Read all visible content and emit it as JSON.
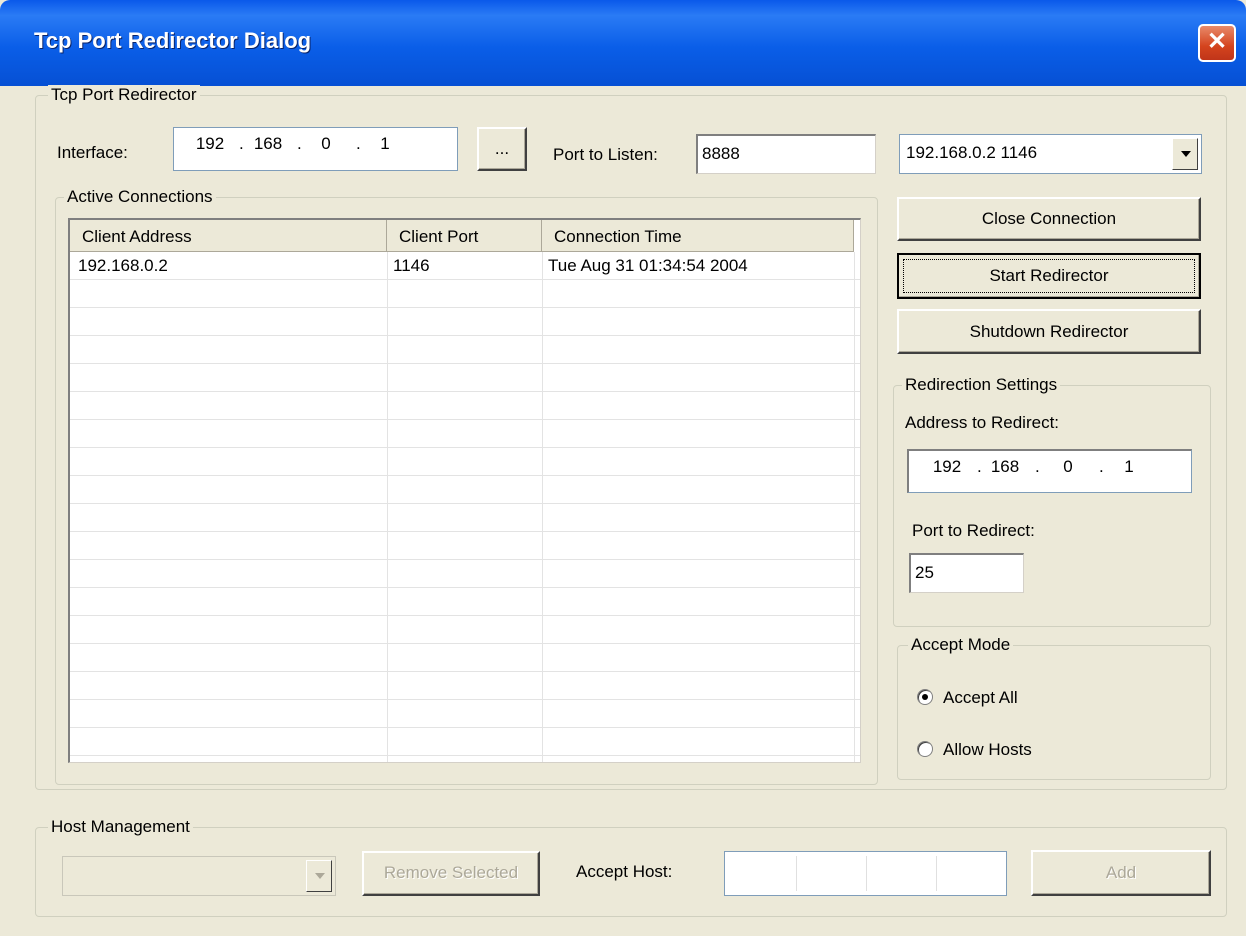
{
  "window": {
    "title": "Tcp Port Redirector Dialog",
    "close_glyph": "✕"
  },
  "redirector_group": {
    "legend": "Tcp Port Redirector",
    "interface_label": "Interface:",
    "interface_ip": [
      "192",
      "168",
      "0",
      "1"
    ],
    "browse_label": "...",
    "port_listen_label": "Port to Listen:",
    "port_listen_value": "8888",
    "connection_select_value": "192.168.0.2 1146"
  },
  "connections": {
    "legend": "Active Connections",
    "columns": [
      "Client Address",
      "Client Port",
      "Connection Time"
    ],
    "rows": [
      [
        "192.168.0.2",
        "1146",
        "Tue Aug 31 01:34:54 2004"
      ]
    ]
  },
  "buttons": {
    "close_connection": "Close Connection",
    "start_redirector": "Start Redirector",
    "shutdown_redirector": "Shutdown Redirector"
  },
  "redirection_settings": {
    "legend": "Redirection Settings",
    "address_label": "Address to Redirect:",
    "address_ip": [
      "192",
      "168",
      "0",
      "1"
    ],
    "port_label": "Port to Redirect:",
    "port_value": "25"
  },
  "accept_mode": {
    "legend": "Accept Mode",
    "options": [
      "Accept All",
      "Allow Hosts"
    ],
    "selected": "Accept All"
  },
  "host_management": {
    "legend": "Host Management",
    "remove_selected": "Remove Selected",
    "accept_host_label": "Accept Host:",
    "add_label": "Add"
  }
}
